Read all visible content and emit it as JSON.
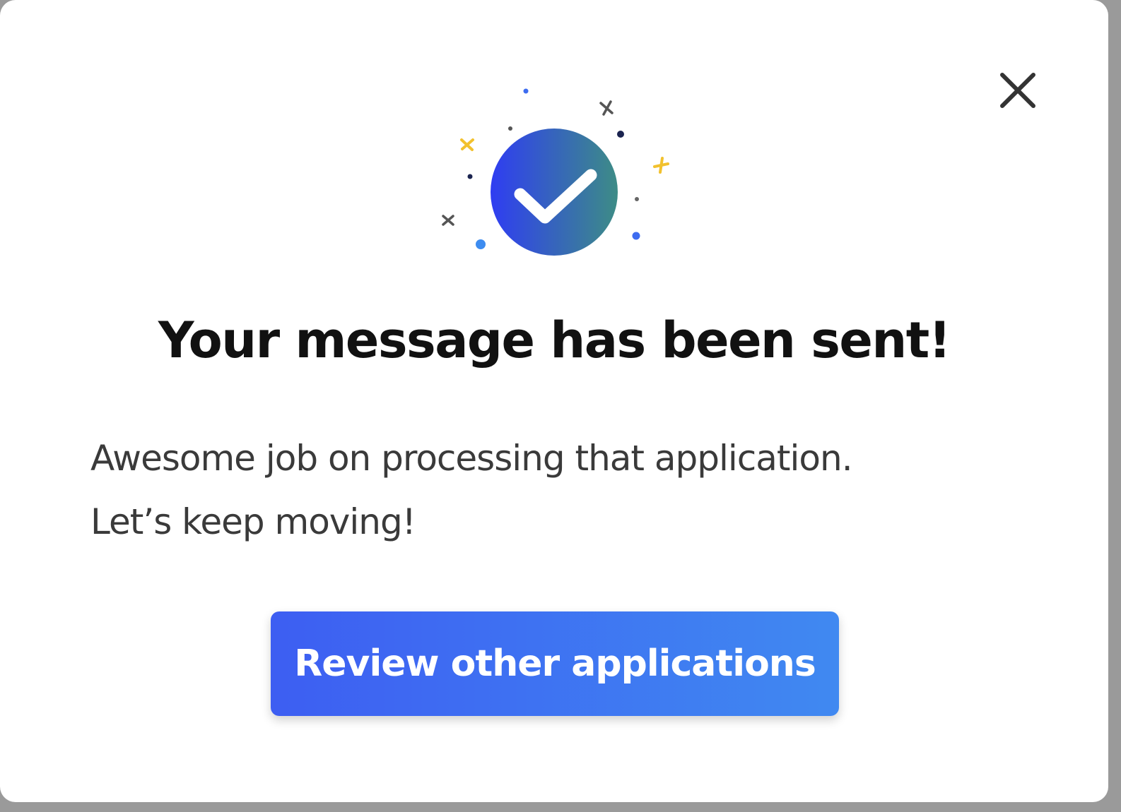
{
  "dialog": {
    "title": "Your message has been sent!",
    "body_line1": "Awesome job on processing that application.",
    "body_line2": "Let’s keep moving!",
    "primary_button_label": "Review other applications",
    "close_icon": "close-icon",
    "illustration_icon": "success-checkmark-icon"
  },
  "colors": {
    "primary_gradient_start": "#3d5ef2",
    "primary_gradient_end": "#4089f1",
    "check_gradient_start": "#2f3df2",
    "check_gradient_end": "#3d8c86",
    "confetti_yellow": "#f2c12e",
    "confetti_navy": "#1b2450",
    "confetti_blue": "#3d8cf0",
    "confetti_gray": "#555555"
  }
}
